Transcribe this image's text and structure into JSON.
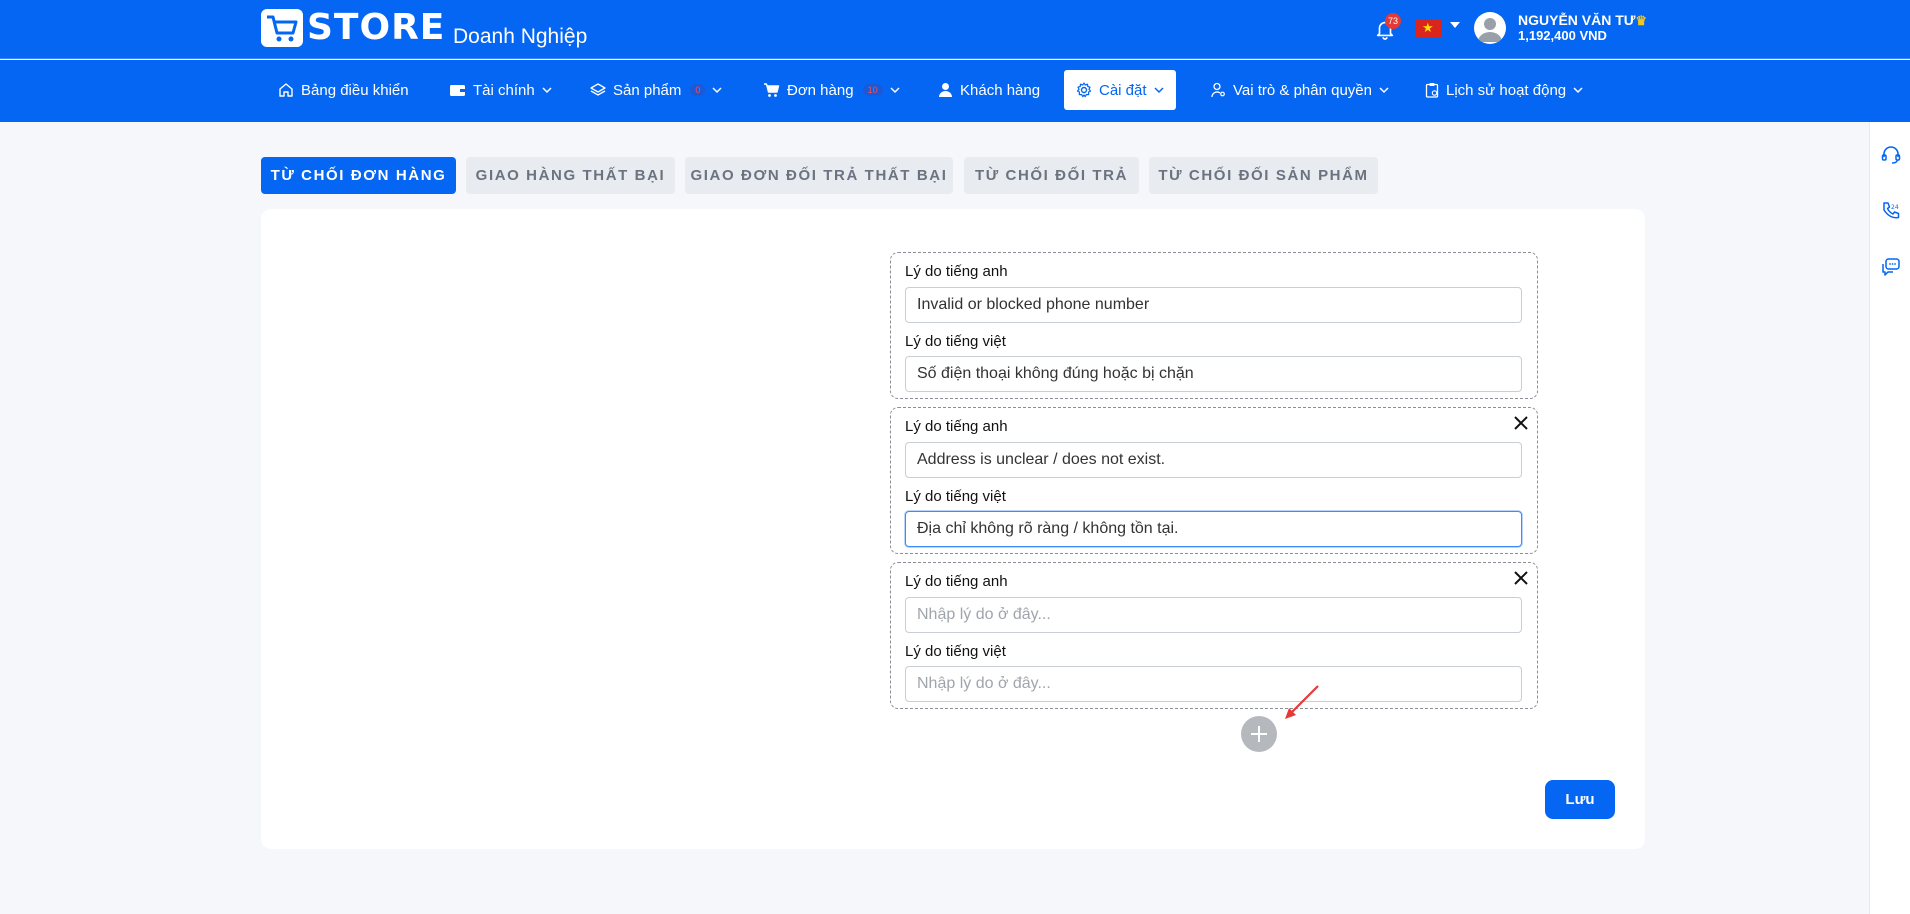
{
  "header": {
    "logo_text": "STORE",
    "logo_subtitle": "Doanh Nghiệp",
    "notification_count": "73",
    "user_name": "NGUYỄN VĂN TƯ",
    "user_balance": "1,192,400 VND"
  },
  "nav": {
    "items": [
      {
        "label": "Bảng điều khiển",
        "icon": "home-icon"
      },
      {
        "label": "Tài chính",
        "icon": "wallet-icon"
      },
      {
        "label": "Sản phẩm",
        "icon": "layers-icon",
        "badge": "0"
      },
      {
        "label": "Đơn hàng",
        "icon": "cart-icon",
        "badge": "10"
      },
      {
        "label": "Khách hàng",
        "icon": "user-icon"
      },
      {
        "label": "Cài đặt",
        "icon": "gear-icon",
        "active": true
      },
      {
        "label": "Vai trò & phân quyền",
        "icon": "user-key-icon"
      },
      {
        "label": "Lịch sử hoạt động",
        "icon": "clipboard-icon"
      }
    ]
  },
  "tabs": [
    {
      "label": "TỪ CHỐI ĐƠN HÀNG",
      "active": true
    },
    {
      "label": "GIAO HÀNG THẤT BẠI"
    },
    {
      "label": "GIAO ĐƠN ĐỐI TRẢ THẤT BẠI"
    },
    {
      "label": "TỪ CHỐI ĐỐI TRẢ"
    },
    {
      "label": "TỪ CHỐI ĐỐI SẢN PHẨM"
    }
  ],
  "form": {
    "label_en": "Lý do tiếng anh",
    "label_vi": "Lý do tiếng việt",
    "placeholder": "Nhập lý do ở đây...",
    "reasons": [
      {
        "en": "Invalid or blocked phone number",
        "vi": "Số điện thoại không đúng hoặc bị chặn"
      },
      {
        "en": "Address is unclear / does not exist.",
        "vi": "Địa chỉ không rõ ràng / không tồn tại."
      },
      {
        "en": "",
        "vi": ""
      }
    ],
    "save_label": "Lưu"
  },
  "colors": {
    "primary": "#0466f2",
    "tab_inactive_bg": "#e8ebf0",
    "annotation_arrow": "#e53935"
  }
}
